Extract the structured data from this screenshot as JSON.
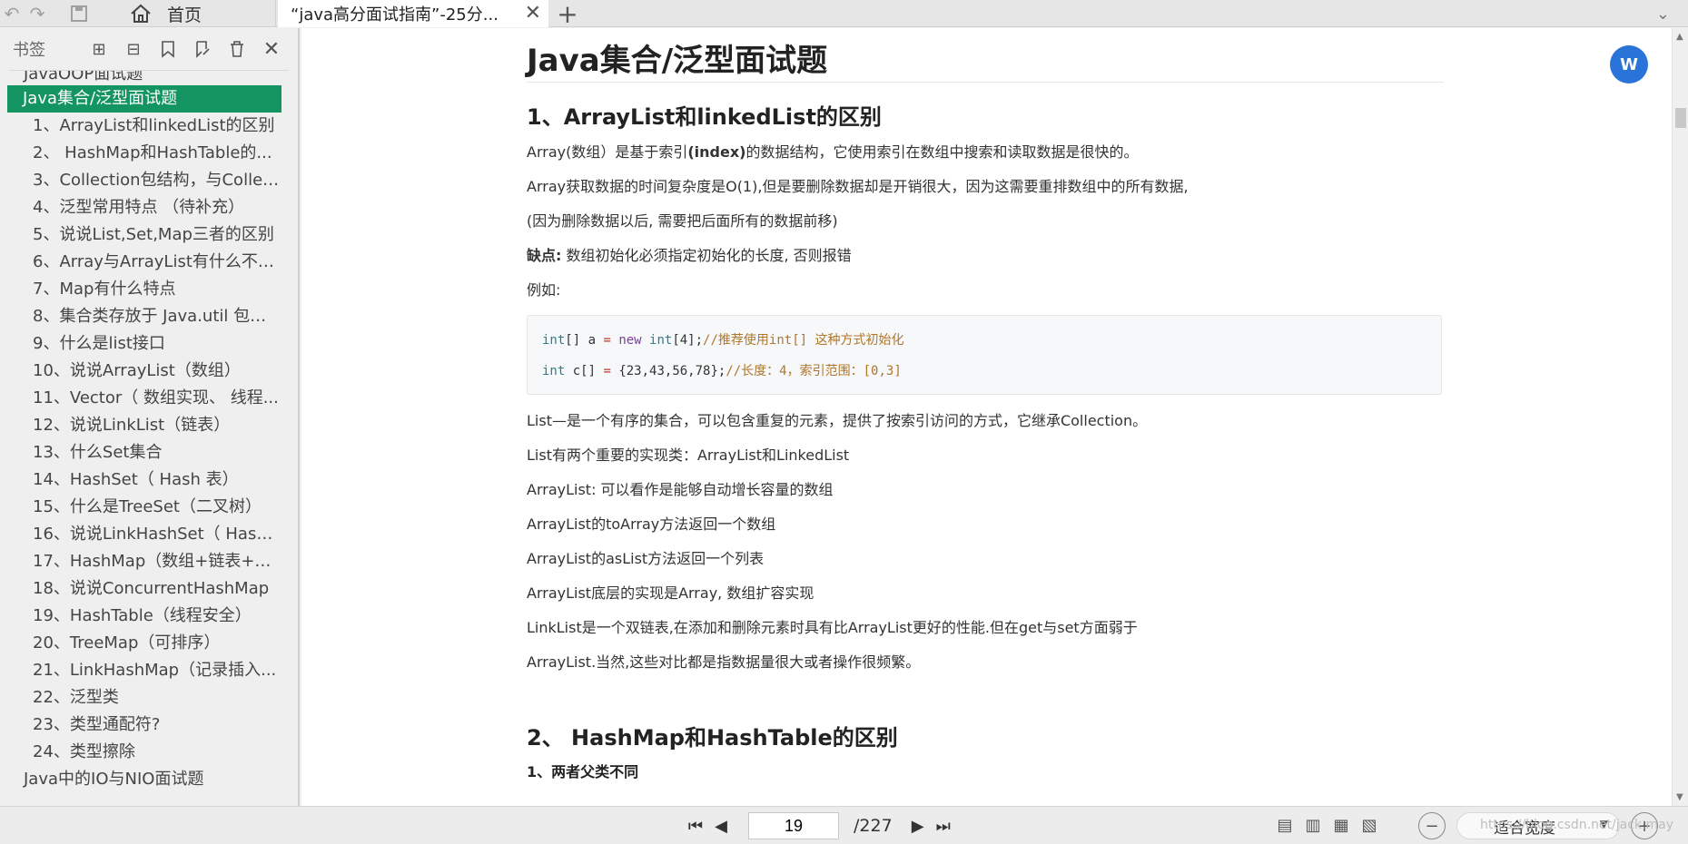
{
  "tabs": {
    "home_label": "首页",
    "doc_label": "“java高分面试指南”-25分...",
    "close_glyph": "✕",
    "new_glyph": "+"
  },
  "sidebar": {
    "title": "书签",
    "items": [
      {
        "label": "JavaOOP面试题",
        "level": 1,
        "cut": true
      },
      {
        "label": "Java集合/泛型面试题",
        "level": 1,
        "active": true
      },
      {
        "label": "1、ArrayList和linkedList的区别",
        "level": 2
      },
      {
        "label": "2、 HashMap和HashTable的...",
        "level": 2
      },
      {
        "label": "3、Collection包结构，与Collec...",
        "level": 2
      },
      {
        "label": "4、泛型常用特点 （待补充）",
        "level": 2
      },
      {
        "label": "5、说说List,Set,Map三者的区别",
        "level": 2
      },
      {
        "label": "6、Array与ArrayList有什么不一...",
        "level": 2
      },
      {
        "label": "7、Map有什么特点",
        "level": 2
      },
      {
        "label": "8、集合类存放于 Java.util 包中...",
        "level": 2
      },
      {
        "label": "9、什么是list接口",
        "level": 2
      },
      {
        "label": "10、说说ArrayList（数组）",
        "level": 2
      },
      {
        "label": "11、Vector（ 数组实现、 线程...",
        "level": 2
      },
      {
        "label": "12、说说LinkList（链表）",
        "level": 2
      },
      {
        "label": "13、什么Set集合",
        "level": 2
      },
      {
        "label": "14、HashSet（ Hash 表）",
        "level": 2
      },
      {
        "label": "15、什么是TreeSet（二叉树）",
        "level": 2
      },
      {
        "label": "16、说说LinkHashSet（ HashS...",
        "level": 2
      },
      {
        "label": "17、HashMap（数组+链表+红...",
        "level": 2
      },
      {
        "label": "18、说说ConcurrentHashMap",
        "level": 2
      },
      {
        "label": "19、HashTable（线程安全）",
        "level": 2
      },
      {
        "label": "20、TreeMap（可排序）",
        "level": 2
      },
      {
        "label": "21、LinkHashMap（记录插入...",
        "level": 2
      },
      {
        "label": "22、泛型类",
        "level": 2
      },
      {
        "label": "23、类型通配符?",
        "level": 2
      },
      {
        "label": "24、类型擦除",
        "level": 2
      },
      {
        "label": "Java中的IO与NIO面试题",
        "level": 1
      }
    ]
  },
  "content": {
    "title": "Java集合/泛型面试题",
    "section1": "1、ArrayList和linkedList的区别",
    "p1_a": "Array(数组）是基于索引",
    "p1_b": "(index)",
    "p1_c": "的数据结构，它使用索引在数组中搜索和读取数据是很快的。",
    "p2": "Array获取数据的时间复杂度是O(1),但是要删除数据却是开销很大，因为这需要重排数组中的所有数据,",
    "p3": "(因为删除数据以后, 需要把后面所有的数据前移)",
    "p4_label": "缺点:",
    "p4_text": " 数组初始化必须指定初始化的长度, 否则报错",
    "p5": "例如:",
    "code": {
      "l1_type": "int",
      "l1_a": "[] a ",
      "l1_eq": "=",
      "l1_new": " new",
      "l1_int": " int",
      "l1_b": "[4];",
      "l1_comment": "//推荐使用int[] 这种方式初始化",
      "l2_type": "int",
      "l2_a": " c[] ",
      "l2_eq": "=",
      "l2_b": " {23,43,56,78};",
      "l2_comment": "//长度：4，索引范围：[0,3]"
    },
    "p6": "List—是一个有序的集合，可以包含重复的元素，提供了按索引访问的方式，它继承Collection。",
    "p7": "List有两个重要的实现类：ArrayList和LinkedList",
    "p8": "ArrayList: 可以看作是能够自动增长容量的数组",
    "p9": "ArrayList的toArray方法返回一个数组",
    "p10": "ArrayList的asList方法返回一个列表",
    "p11": "ArrayList底层的实现是Array, 数组扩容实现",
    "p12": "LinkList是一个双链表,在添加和删除元素时具有比ArrayList更好的性能.但在get与set方面弱于",
    "p13": "ArrayList.当然,这些对比都是指数据量很大或者操作很频繁。",
    "section2": "2、 HashMap和HashTable的区别",
    "sub1": "1、两者父类不同"
  },
  "bottom": {
    "page_current": "19",
    "page_total": "/227",
    "zoom_label": "适合宽度",
    "watermark": "https://blog.csdn.net/jack.may"
  },
  "colors": {
    "accent": "#149461",
    "float_button": "#2a73d8"
  }
}
